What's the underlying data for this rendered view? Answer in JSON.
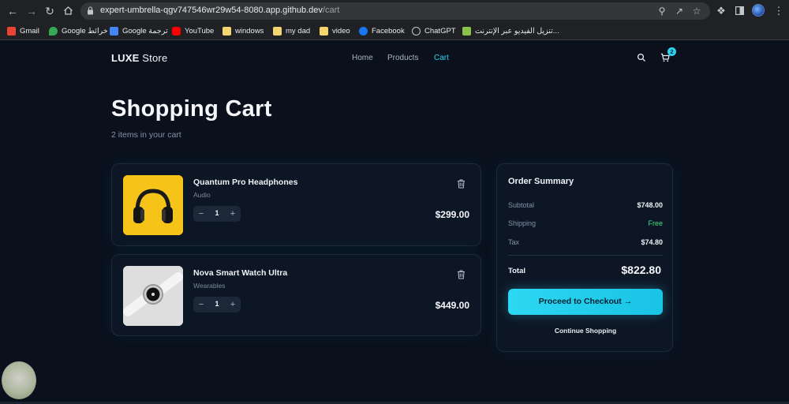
{
  "browser": {
    "url_host": "expert-umbrella-qgv747546wr29w54-8080.app.github.dev",
    "url_path": "/cart",
    "bookmarks": [
      {
        "label": "Gmail",
        "icon": "gmail-icon"
      },
      {
        "label": "Google خرائط",
        "icon": "maps-icon"
      },
      {
        "label": "Google ترجمة",
        "icon": "translate-icon"
      },
      {
        "label": "YouTube",
        "icon": "youtube-icon"
      },
      {
        "label": "windows",
        "icon": "folder-icon"
      },
      {
        "label": "my dad",
        "icon": "folder-icon"
      },
      {
        "label": "video",
        "icon": "folder-icon"
      },
      {
        "label": "Facebook",
        "icon": "facebook-icon"
      },
      {
        "label": "ChatGPT",
        "icon": "chatgpt-icon"
      },
      {
        "label": "تنزيل الفيديو عبر الإنترنت...",
        "icon": "download-icon"
      }
    ]
  },
  "header": {
    "logo_bold": "LUXE",
    "logo_rest": " Store",
    "nav": [
      "Home",
      "Products",
      "Cart"
    ],
    "active_nav": "Cart",
    "cart_count": "2"
  },
  "main": {
    "title": "Shopping Cart",
    "subtitle": "2 items in your cart"
  },
  "cart_items": [
    {
      "name": "Quantum Pro Headphones",
      "category": "Audio",
      "quantity": "1",
      "price": "$299.00",
      "image": "headphones-image"
    },
    {
      "name": "Nova Smart Watch Ultra",
      "category": "Wearables",
      "quantity": "1",
      "price": "$449.00",
      "image": "smartwatch-image"
    }
  ],
  "summary": {
    "title": "Order Summary",
    "rows": [
      {
        "label": "Subtotal",
        "value": "$748.00"
      },
      {
        "label": "Shipping",
        "value": "Free"
      },
      {
        "label": "Tax",
        "value": "$74.80"
      }
    ],
    "total_label": "Total",
    "total_value": "$822.80",
    "checkout_label": "Proceed to Checkout",
    "continue_label": "Continue Shopping"
  },
  "colors": {
    "background": "#0a111d",
    "accent": "#27d3ee",
    "free": "#3ee07a"
  }
}
